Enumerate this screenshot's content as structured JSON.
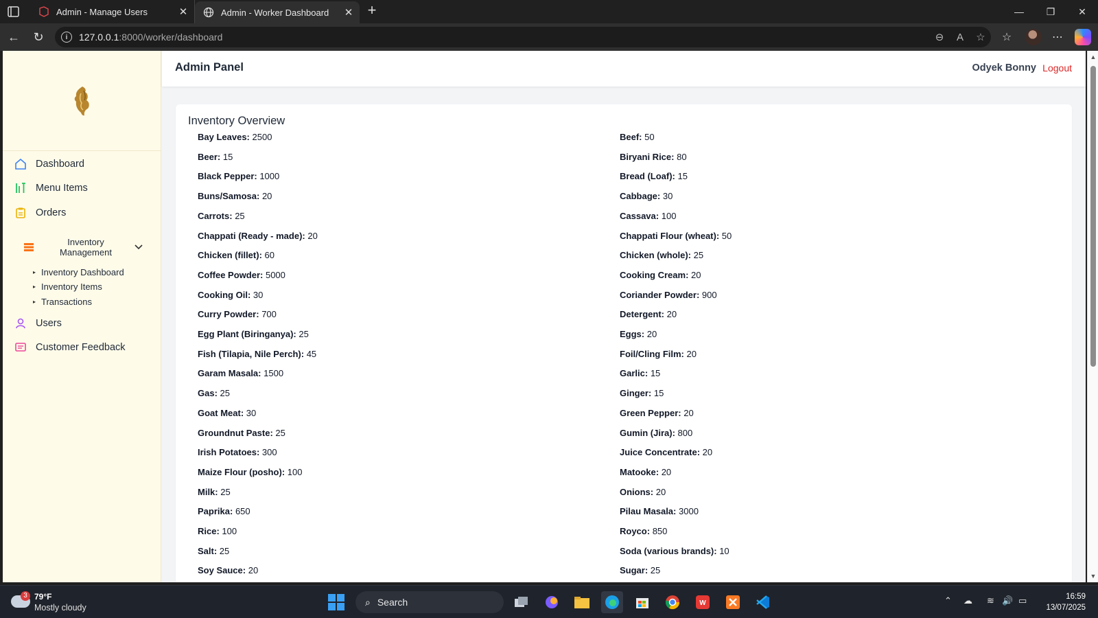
{
  "browser": {
    "tabs": [
      {
        "title": "Admin - Manage Users"
      },
      {
        "title": "Admin - Worker Dashboard"
      }
    ],
    "url_host": "127.0.0.1",
    "url_rest": ":8000/worker/dashboard"
  },
  "sidebar": {
    "items": [
      {
        "label": "Dashboard",
        "icon": "home-icon",
        "color": "#3b82f6"
      },
      {
        "label": "Menu Items",
        "icon": "utensils-icon",
        "color": "#22c55e"
      },
      {
        "label": "Orders",
        "icon": "clipboard-icon",
        "color": "#eab308"
      }
    ],
    "inventory": {
      "label": "Inventory Management",
      "icon": "layers-icon",
      "color": "#f97316",
      "subitems": [
        "Inventory Dashboard",
        "Inventory Items",
        "Transactions"
      ]
    },
    "bottom_items": [
      {
        "label": "Users",
        "icon": "user-icon",
        "color": "#a855f7"
      },
      {
        "label": "Customer Feedback",
        "icon": "feedback-icon",
        "color": "#ec4899"
      }
    ]
  },
  "topbar": {
    "title": "Admin Panel",
    "user": "Odyek Bonny",
    "logout": "Logout"
  },
  "inventory": {
    "heading": "Inventory Overview",
    "left": [
      {
        "name": "Bay Leaves:",
        "qty": "2500"
      },
      {
        "name": "Beer:",
        "qty": "15"
      },
      {
        "name": "Black Pepper:",
        "qty": "1000"
      },
      {
        "name": "Buns/Samosa:",
        "qty": "20"
      },
      {
        "name": "Carrots:",
        "qty": "25"
      },
      {
        "name": "Chappati (Ready - made):",
        "qty": "20"
      },
      {
        "name": "Chicken (fillet):",
        "qty": "60"
      },
      {
        "name": "Coffee Powder:",
        "qty": "5000"
      },
      {
        "name": "Cooking Oil:",
        "qty": "30"
      },
      {
        "name": "Curry Powder:",
        "qty": "700"
      },
      {
        "name": "Egg Plant (Biringanya):",
        "qty": "25"
      },
      {
        "name": "Fish (Tilapia, Nile Perch):",
        "qty": "45"
      },
      {
        "name": "Garam Masala:",
        "qty": "1500"
      },
      {
        "name": "Gas:",
        "qty": "25"
      },
      {
        "name": "Goat Meat:",
        "qty": "30"
      },
      {
        "name": "Groundnut Paste:",
        "qty": "25"
      },
      {
        "name": "Irish Potatoes:",
        "qty": "300"
      },
      {
        "name": "Maize Flour (posho):",
        "qty": "100"
      },
      {
        "name": "Milk:",
        "qty": "25"
      },
      {
        "name": "Paprika:",
        "qty": "650"
      },
      {
        "name": "Rice:",
        "qty": "100"
      },
      {
        "name": "Salt:",
        "qty": "25"
      },
      {
        "name": "Soy Sauce:",
        "qty": "20"
      }
    ],
    "right": [
      {
        "name": "Beef:",
        "qty": "50"
      },
      {
        "name": "Biryani Rice:",
        "qty": "80"
      },
      {
        "name": "Bread (Loaf):",
        "qty": "15"
      },
      {
        "name": "Cabbage:",
        "qty": "30"
      },
      {
        "name": "Cassava:",
        "qty": "100"
      },
      {
        "name": "Chappati Flour (wheat):",
        "qty": "50"
      },
      {
        "name": "Chicken (whole):",
        "qty": "25"
      },
      {
        "name": "Cooking Cream:",
        "qty": "20"
      },
      {
        "name": "Coriander Powder:",
        "qty": "900"
      },
      {
        "name": "Detergent:",
        "qty": "20"
      },
      {
        "name": "Eggs:",
        "qty": "20"
      },
      {
        "name": "Foil/Cling Film:",
        "qty": "20"
      },
      {
        "name": "Garlic:",
        "qty": "15"
      },
      {
        "name": "Ginger:",
        "qty": "15"
      },
      {
        "name": "Green Pepper:",
        "qty": "20"
      },
      {
        "name": "Gumin (Jira):",
        "qty": "800"
      },
      {
        "name": "Juice Concentrate:",
        "qty": "20"
      },
      {
        "name": "Matooke:",
        "qty": "20"
      },
      {
        "name": "Onions:",
        "qty": "20"
      },
      {
        "name": "Pilau Masala:",
        "qty": "3000"
      },
      {
        "name": "Royco:",
        "qty": "850"
      },
      {
        "name": "Soda (various brands):",
        "qty": "10"
      },
      {
        "name": "Sugar:",
        "qty": "25"
      }
    ]
  },
  "taskbar": {
    "weather_temp": "79°F",
    "weather_cond": "Mostly cloudy",
    "weather_badge": "3",
    "search": "Search",
    "time": "16:59",
    "date": "13/07/2025"
  }
}
